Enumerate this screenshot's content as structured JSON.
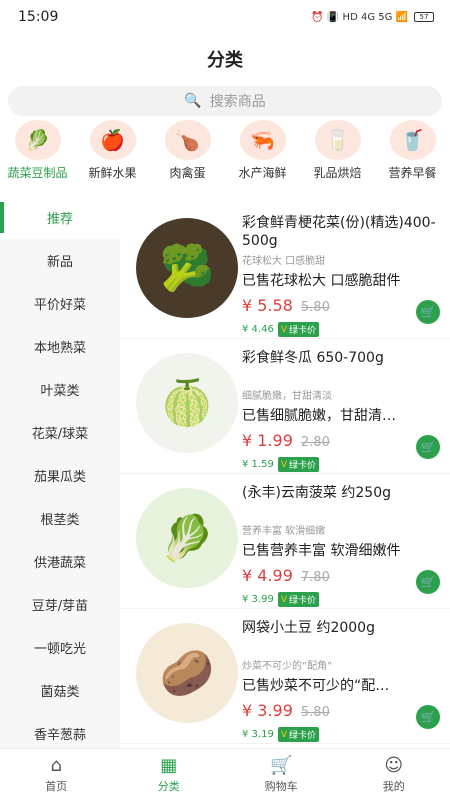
{
  "status": {
    "time": "15:09",
    "icons": "⏰ 📳 HD 4G 5G 📶",
    "battery": "57"
  },
  "header": {
    "title": "分类"
  },
  "search": {
    "placeholder": "搜索商品"
  },
  "categories": [
    {
      "label": "蔬菜豆制品",
      "icon": "🥬",
      "active": true
    },
    {
      "label": "新鲜水果",
      "icon": "🍎"
    },
    {
      "label": "肉禽蛋",
      "icon": "🍗"
    },
    {
      "label": "水产海鲜",
      "icon": "🦐"
    },
    {
      "label": "乳品烘焙",
      "icon": "🥛"
    },
    {
      "label": "营养早餐",
      "icon": "🥤"
    }
  ],
  "sidebar": [
    {
      "label": "推荐",
      "active": true
    },
    {
      "label": "新品"
    },
    {
      "label": "平价好菜"
    },
    {
      "label": "本地熟菜"
    },
    {
      "label": "叶菜类"
    },
    {
      "label": "花菜/球菜"
    },
    {
      "label": "茄果瓜类"
    },
    {
      "label": "根茎类"
    },
    {
      "label": "供港蔬菜"
    },
    {
      "label": "豆芽/芽苗"
    },
    {
      "label": "一顿吃光"
    },
    {
      "label": "菌菇类"
    },
    {
      "label": "香辛葱蒜"
    }
  ],
  "products": [
    {
      "name": "彩食鲜青梗花菜(份)(精选)400-500g",
      "tag": "花球松大 口感脆甜",
      "sold": "已售花球松大 口感脆甜件",
      "price": "¥ 5.58",
      "old": "5.80",
      "member": "¥ 4.46",
      "badge": "绿卡价",
      "icon": "🥦"
    },
    {
      "name": "彩食鲜冬瓜 650-700g",
      "tag": "细腻脆嫩，甘甜清淡",
      "sold": "已售细腻脆嫩，甘甜清…",
      "price": "¥ 1.99",
      "old": "2.80",
      "member": "¥ 1.59",
      "badge": "绿卡价",
      "icon": "🍈"
    },
    {
      "name": "(永丰)云南菠菜 约250g",
      "tag": "营养丰富 软滑细嫩",
      "sold": "已售营养丰富 软滑细嫩件",
      "price": "¥ 4.99",
      "old": "7.80",
      "member": "¥ 3.99",
      "badge": "绿卡价",
      "icon": "🥬"
    },
    {
      "name": "网袋小土豆 约2000g",
      "tag": "炒菜不可少的“配角”",
      "sold": "已售炒菜不可少的“配…",
      "price": "¥ 3.99",
      "old": "5.80",
      "member": "¥ 3.19",
      "badge": "绿卡价",
      "icon": "🥔"
    }
  ],
  "tabbar": [
    {
      "label": "首页",
      "icon": "⌂"
    },
    {
      "label": "分类",
      "icon": "▦",
      "active": true
    },
    {
      "label": "购物车",
      "icon": "🛒"
    },
    {
      "label": "我的",
      "icon": "☺"
    }
  ]
}
